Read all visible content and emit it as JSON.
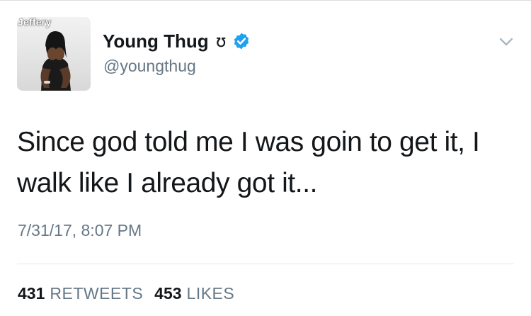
{
  "tweet": {
    "author": {
      "display_name": "Young Thug",
      "name_glyph": "ʊ",
      "handle": "@youngthug",
      "verified": true,
      "avatar_overlay_text": "Jeffery"
    },
    "menu_icon": "chevron-down-icon",
    "text": "Since god told me I was goin to get it, I walk like I already got it...",
    "timestamp": "7/31/17, 8:07 PM",
    "stats": {
      "retweets_count": "431",
      "retweets_label": "RETWEETS",
      "likes_count": "453",
      "likes_label": "LIKES"
    }
  },
  "colors": {
    "text_primary": "#14171a",
    "text_secondary": "#657786",
    "verified_blue": "#1da1f2",
    "divider": "#e1e8ed"
  }
}
